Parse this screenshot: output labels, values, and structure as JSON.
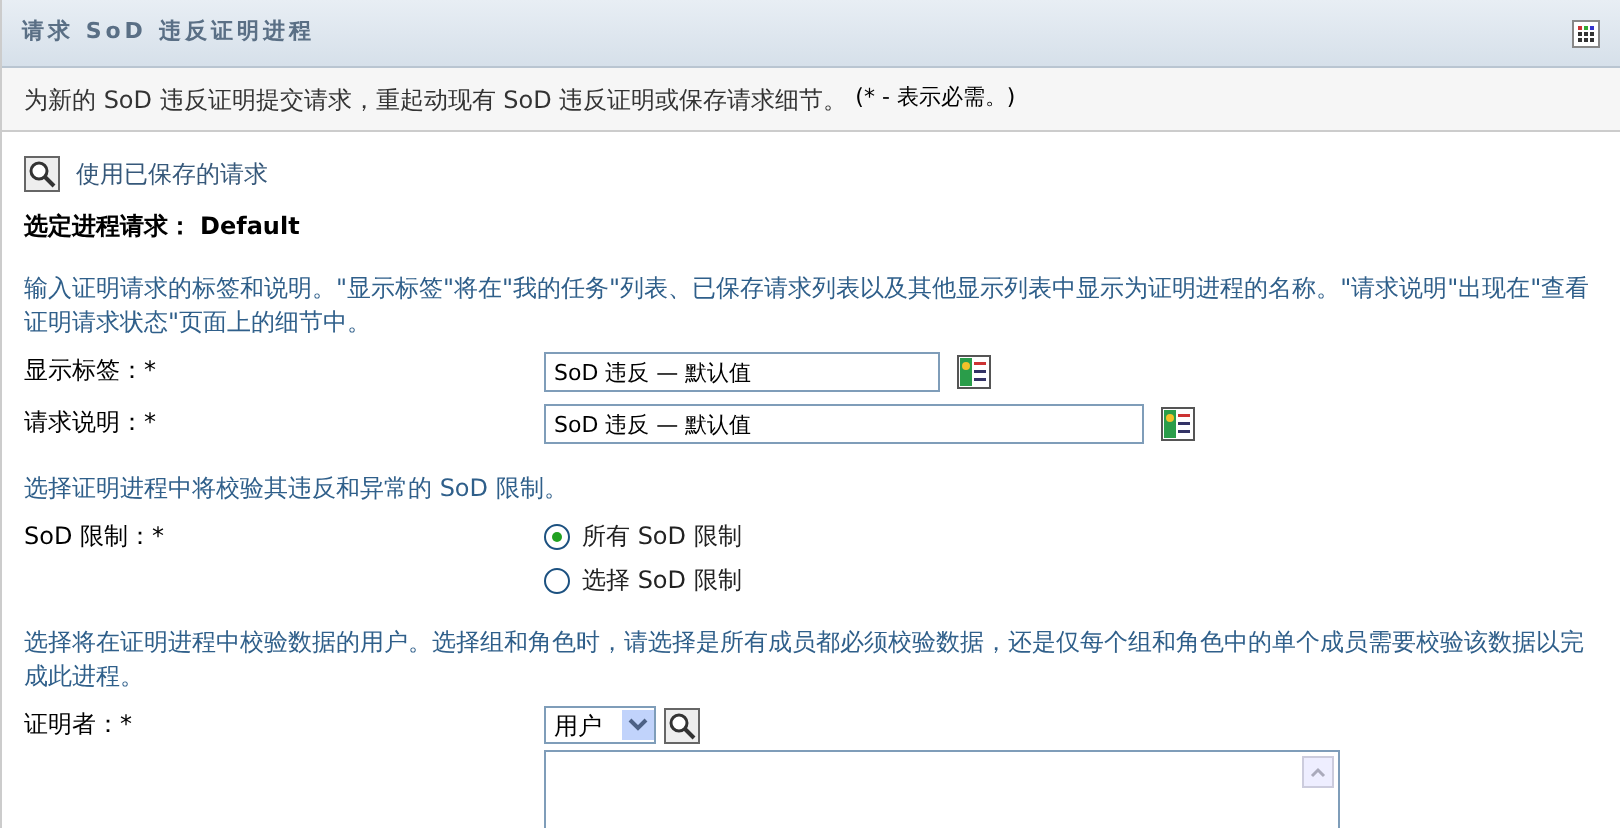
{
  "header": {
    "title": "请求 SoD 违反证明进程"
  },
  "intro": {
    "text": "为新的 SoD 违反证明提交请求，重起动现有 SoD 违反证明或保存请求细节。",
    "required_note": "(* - 表示必需。)"
  },
  "saved_link": "使用已保存的请求",
  "selected_request": {
    "label": "选定进程请求：",
    "value": "Default"
  },
  "sections": [
    {
      "hint": "输入证明请求的标签和说明。\"显示标签\"将在\"我的任务\"列表、已保存请求列表以及其他显示列表中显示为证明进程的名称。\"请求说明\"出现在\"查看证明请求状态\"页面上的细节中。",
      "fields": [
        {
          "kind": "text",
          "label": "显示标签：*",
          "value": "SoD 违反 — 默认值",
          "wide": false
        },
        {
          "kind": "text",
          "label": "请求说明：*",
          "value": "SoD 违反 — 默认值",
          "wide": true
        }
      ]
    },
    {
      "hint": "选择证明进程中将校验其违反和异常的 SoD 限制。",
      "fields": [
        {
          "kind": "radio",
          "label": "SoD 限制：*",
          "options": [
            {
              "label": "所有 SoD 限制",
              "selected": true
            },
            {
              "label": "选择 SoD 限制",
              "selected": false
            }
          ]
        }
      ]
    },
    {
      "hint": "选择将在证明进程中校验数据的用户。选择组和角色时，请选择是所有成员都必须校验数据，还是仅每个组和角色中的单个成员需要校验该数据以完成此进程。",
      "fields": [
        {
          "kind": "picker",
          "label": "证明者：*",
          "select": "用户"
        }
      ]
    }
  ]
}
